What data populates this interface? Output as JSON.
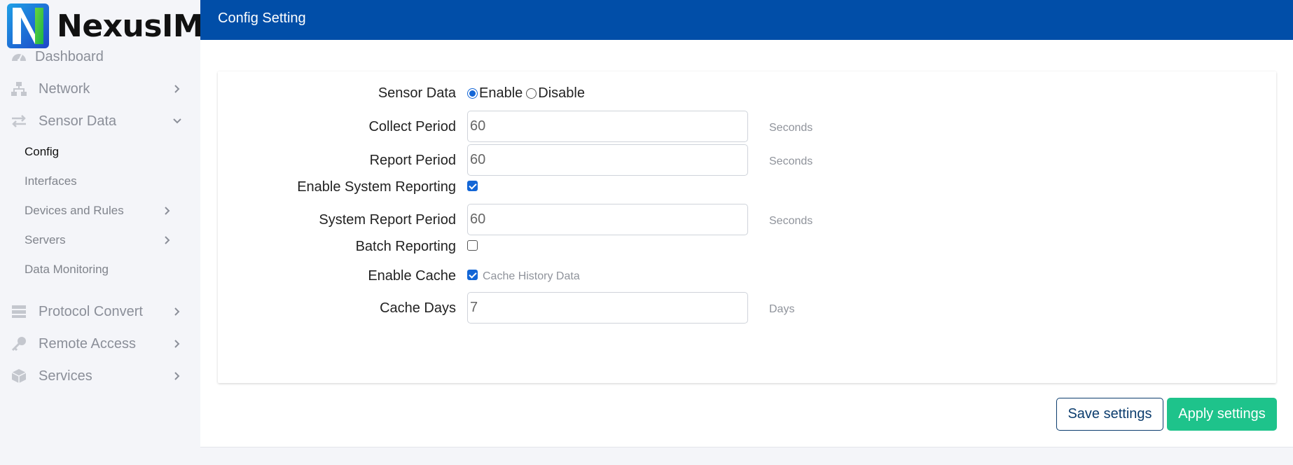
{
  "brand": {
    "name": "NexusIM"
  },
  "sidebar": {
    "items": [
      {
        "label": "Dashboard",
        "icon": "dashboard-gauge-icon"
      },
      {
        "label": "Network",
        "icon": "network-icon"
      },
      {
        "label": "Sensor Data",
        "icon": "transfer-arrows-icon",
        "expanded": true
      },
      {
        "label": "Protocol Convert",
        "icon": "server-stack-icon"
      },
      {
        "label": "Remote Access",
        "icon": "key-icon"
      },
      {
        "label": "Services",
        "icon": "cube-icon"
      }
    ],
    "sensor_sub": [
      {
        "label": "Config",
        "active": true
      },
      {
        "label": "Interfaces"
      },
      {
        "label": "Devices and Rules"
      },
      {
        "label": "Servers"
      },
      {
        "label": "Data Monitoring"
      }
    ]
  },
  "header": {
    "title": "Config Setting"
  },
  "form": {
    "sensor_data": {
      "label": "Sensor Data",
      "enable_label": "Enable",
      "disable_label": "Disable",
      "selected": "Enable"
    },
    "collect_period": {
      "label": "Collect Period",
      "value": "60",
      "unit": "Seconds"
    },
    "report_period": {
      "label": "Report Period",
      "value": "60",
      "unit": "Seconds"
    },
    "enable_system_reporting": {
      "label": "Enable System Reporting",
      "checked": true
    },
    "system_report_period": {
      "label": "System Report Period",
      "value": "60",
      "unit": "Seconds"
    },
    "batch_reporting": {
      "label": "Batch Reporting",
      "checked": false
    },
    "enable_cache": {
      "label": "Enable Cache",
      "checked": true,
      "note": "Cache History Data"
    },
    "cache_days": {
      "label": "Cache Days",
      "value": "7",
      "unit": "Days"
    }
  },
  "actions": {
    "save_label": "Save settings",
    "apply_label": "Apply settings"
  },
  "colors": {
    "header": "#014ea8",
    "apply": "#1ec38b",
    "save_border": "#0c3d6e",
    "checkbox": "#1366d6"
  }
}
